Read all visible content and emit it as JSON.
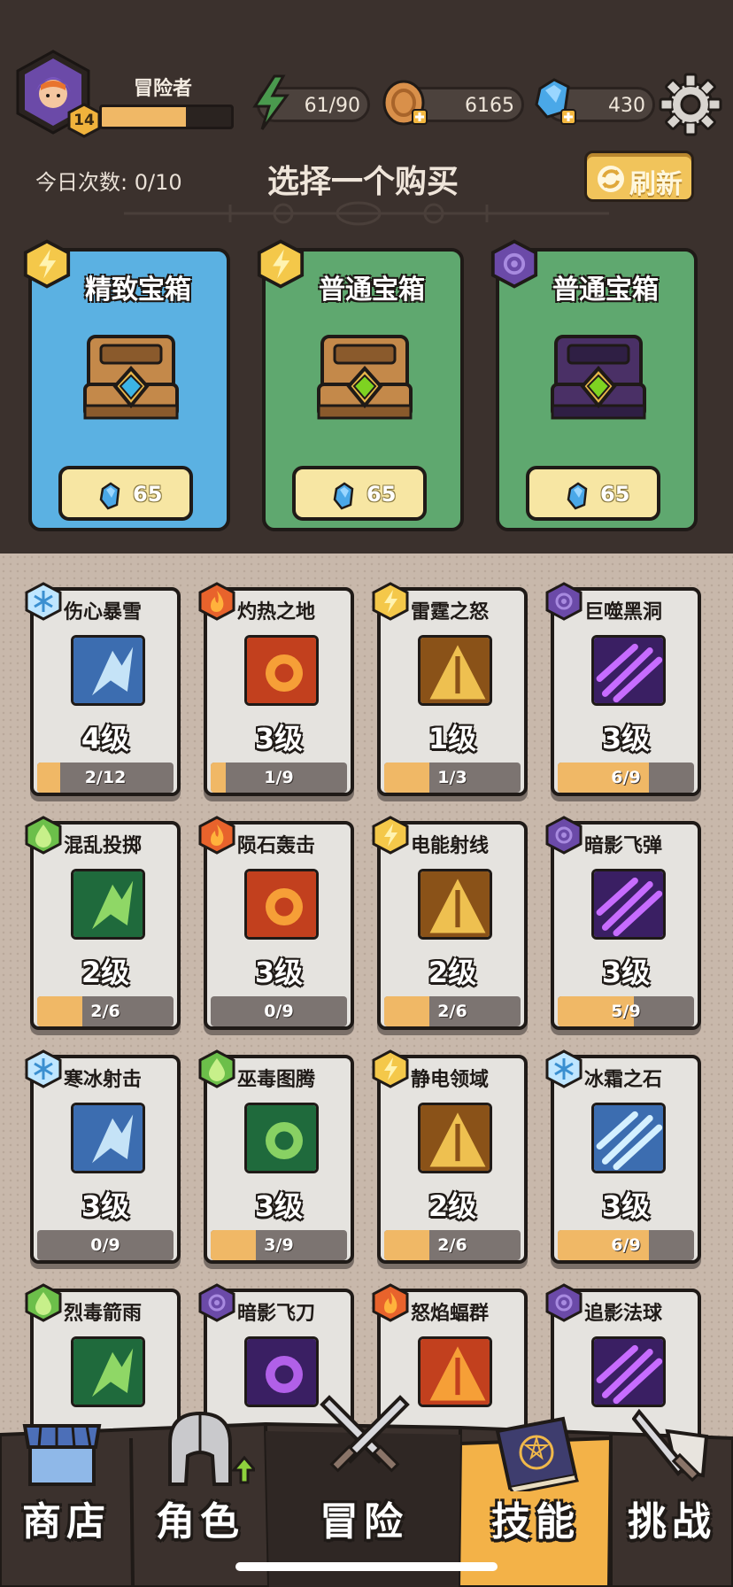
{
  "player": {
    "name": "冒险者",
    "level": "14",
    "xp_fraction": 0.65
  },
  "resources": {
    "energy": "61/90",
    "coins": "6165",
    "gems": "430"
  },
  "shop": {
    "daily_label": "今日次数: 0/10",
    "title": "选择一个购买",
    "refresh_label": "刷新",
    "chests": [
      {
        "name": "精致宝箱",
        "price": "65",
        "color": "#5bb1e2",
        "element": "lightning"
      },
      {
        "name": "普通宝箱",
        "price": "65",
        "color": "#5fa86f",
        "element": "lightning"
      },
      {
        "name": "普通宝箱",
        "price": "65",
        "color": "#5fa86f",
        "element": "shadow"
      }
    ]
  },
  "skills": [
    {
      "name": "伤心暴雪",
      "level": "4级",
      "progress": "2/12",
      "fraction": 0.17,
      "element": "ice"
    },
    {
      "name": "灼热之地",
      "level": "3级",
      "progress": "1/9",
      "fraction": 0.11,
      "element": "fire"
    },
    {
      "name": "雷霆之怒",
      "level": "1级",
      "progress": "1/3",
      "fraction": 0.33,
      "element": "lightning"
    },
    {
      "name": "巨噬黑洞",
      "level": "3级",
      "progress": "6/9",
      "fraction": 0.67,
      "element": "shadow"
    },
    {
      "name": "混乱投掷",
      "level": "2级",
      "progress": "2/6",
      "fraction": 0.33,
      "element": "poison"
    },
    {
      "name": "陨石轰击",
      "level": "3级",
      "progress": "0/9",
      "fraction": 0.0,
      "element": "fire"
    },
    {
      "name": "电能射线",
      "level": "2级",
      "progress": "2/6",
      "fraction": 0.33,
      "element": "lightning"
    },
    {
      "name": "暗影飞弹",
      "level": "3级",
      "progress": "5/9",
      "fraction": 0.56,
      "element": "shadow"
    },
    {
      "name": "寒冰射击",
      "level": "3级",
      "progress": "0/9",
      "fraction": 0.0,
      "element": "ice"
    },
    {
      "name": "巫毒图腾",
      "level": "3级",
      "progress": "3/9",
      "fraction": 0.33,
      "element": "poison"
    },
    {
      "name": "静电领域",
      "level": "2级",
      "progress": "2/6",
      "fraction": 0.33,
      "element": "lightning"
    },
    {
      "name": "冰霜之石",
      "level": "3级",
      "progress": "6/9",
      "fraction": 0.67,
      "element": "ice"
    },
    {
      "name": "烈毒箭雨",
      "element": "poison"
    },
    {
      "name": "暗影飞刀",
      "element": "shadow"
    },
    {
      "name": "怒焰蝠群",
      "element": "fire"
    },
    {
      "name": "追影法球",
      "element": "shadow"
    }
  ],
  "nav": {
    "items": [
      {
        "label": "商店",
        "active": false
      },
      {
        "label": "角色",
        "active": false
      },
      {
        "label": "冒险",
        "active": false
      },
      {
        "label": "技能",
        "active": true
      },
      {
        "label": "挑战",
        "active": false
      }
    ]
  }
}
